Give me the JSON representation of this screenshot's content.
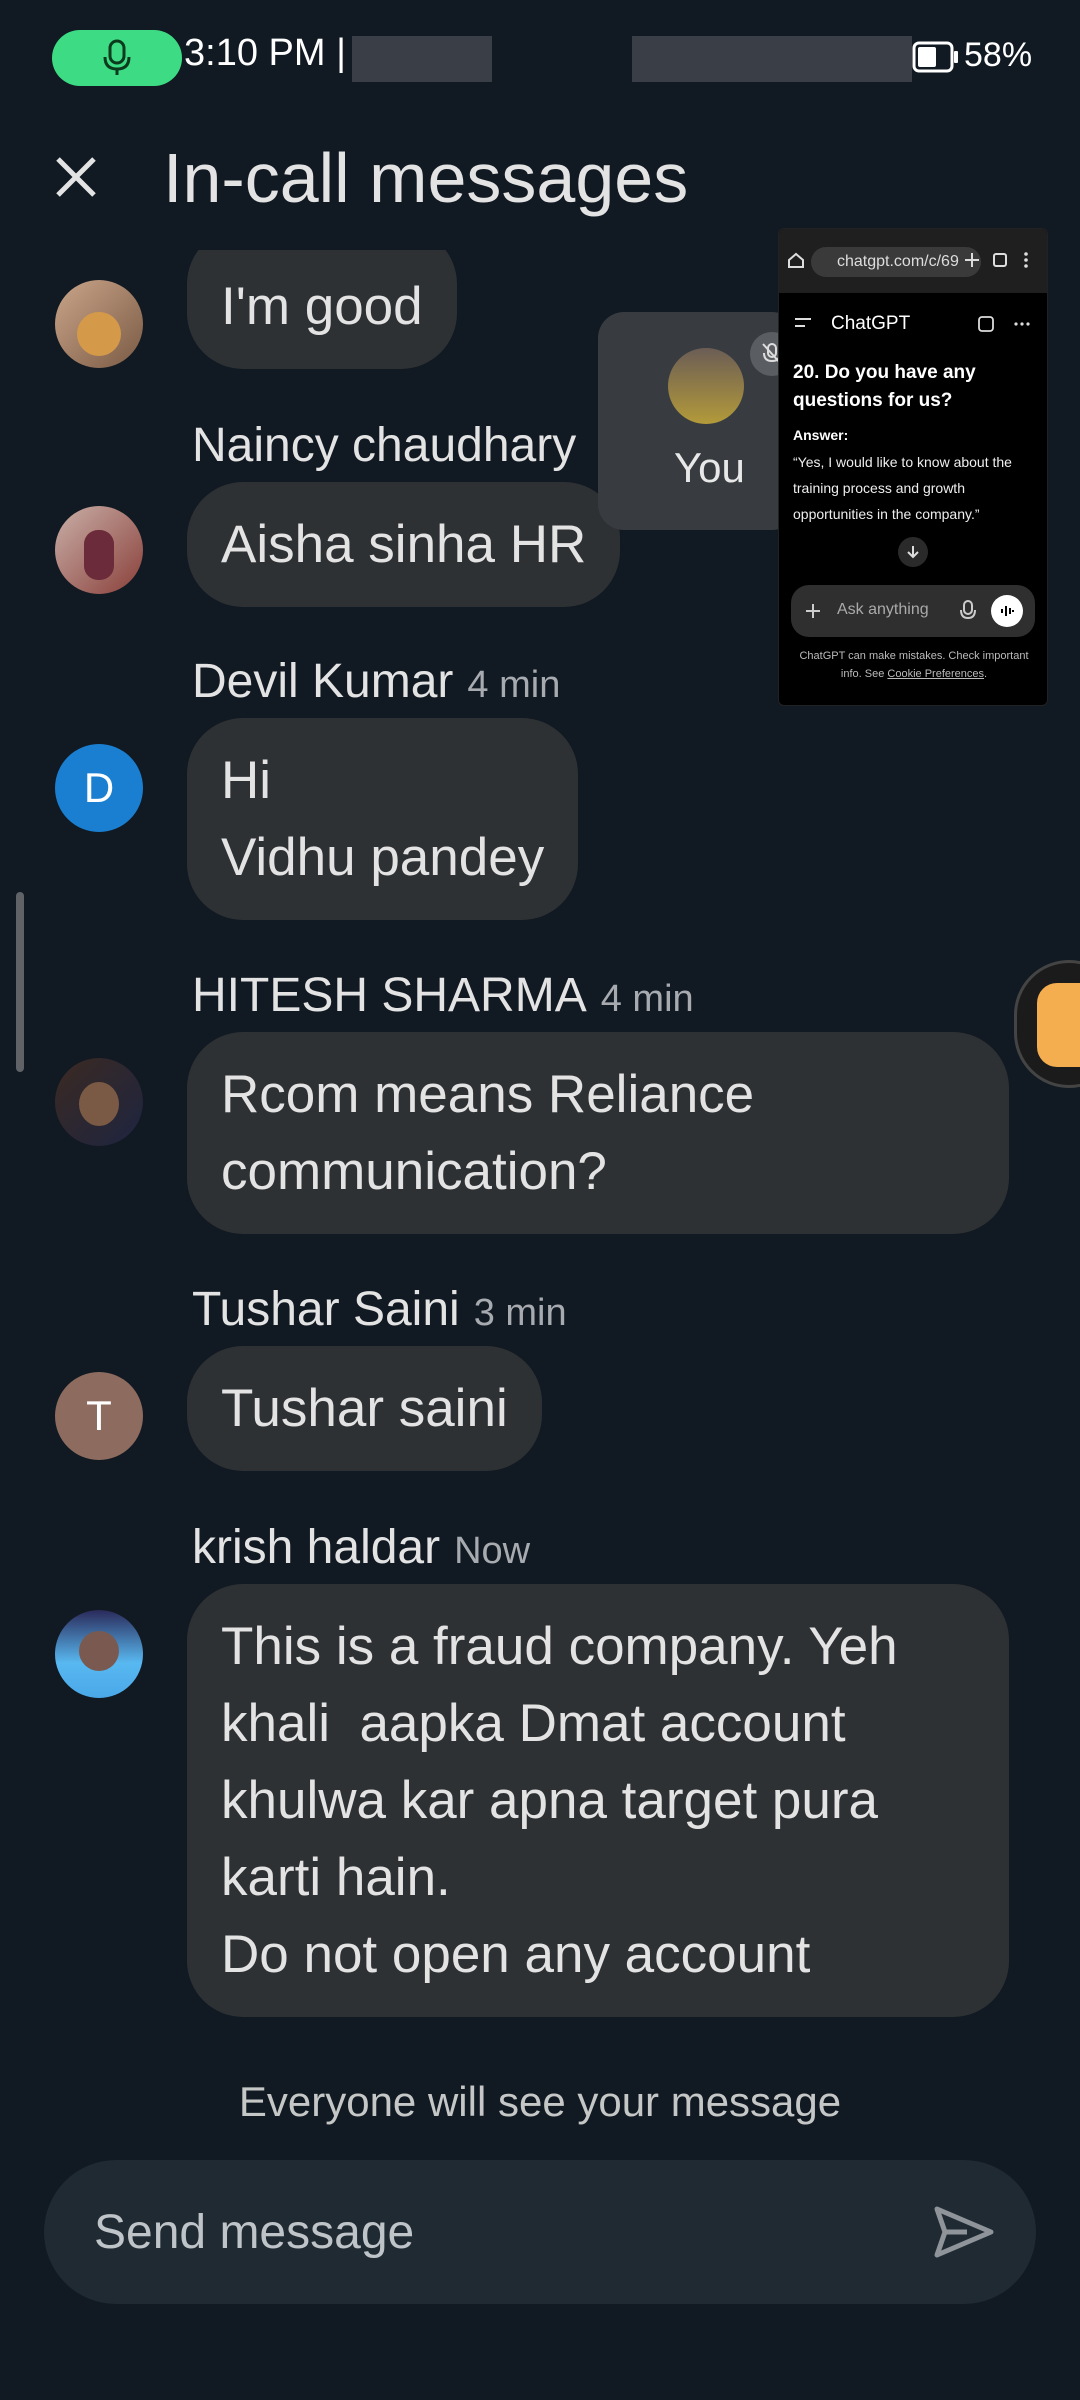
{
  "status_bar": {
    "time": "3:10 PM |",
    "battery": "58%",
    "mic_color": "#3ddc84"
  },
  "header": {
    "title": "In-call messages",
    "close_icon": "close-icon"
  },
  "messages": [
    {
      "sender": "",
      "time": "",
      "text": "I'm good",
      "avatar": "photo"
    },
    {
      "sender": "Naincy chaudhary",
      "time": "",
      "text": "Aisha sinha HR",
      "avatar": "photo"
    },
    {
      "sender": "Devil Kumar",
      "time": "4 min",
      "text": "Hi\nVidhu pandey",
      "avatar_letter": "D",
      "avatar_color": "#1a7fd0"
    },
    {
      "sender": "HITESH SHARMA",
      "time": "4 min",
      "text": "Rcom means Reliance\ncommunication?",
      "avatar": "photo"
    },
    {
      "sender": "Tushar Saini",
      "time": "3 min",
      "text": "Tushar saini",
      "avatar_letter": "T",
      "avatar_color": "#8d6b5f"
    },
    {
      "sender": "krish haldar",
      "time": "Now",
      "text": "This is a fraud company. Yeh\nkhali  aapka Dmat account\nkhulwa kar apna target pura\nkarti hain.\nDo not open any account",
      "avatar": "photo"
    }
  ],
  "self_tile": {
    "label": "You"
  },
  "pip": {
    "url": "chatgpt.com/c/69",
    "tab_title": "ChatGPT",
    "question": "20. Do you have any questions for us?",
    "answer_label": "Answer:",
    "answer": "“Yes, I would like to know about the training process and growth opportunities in the company.”",
    "input_placeholder": "Ask anything",
    "disclaimer": "ChatGPT can make mistakes. Check important info. See",
    "disclaimer_link": "Cookie Preferences",
    "disclaimer_end": "."
  },
  "footer": {
    "notice": "Everyone will see your message",
    "placeholder": "Send message",
    "send_icon": "send-icon"
  }
}
